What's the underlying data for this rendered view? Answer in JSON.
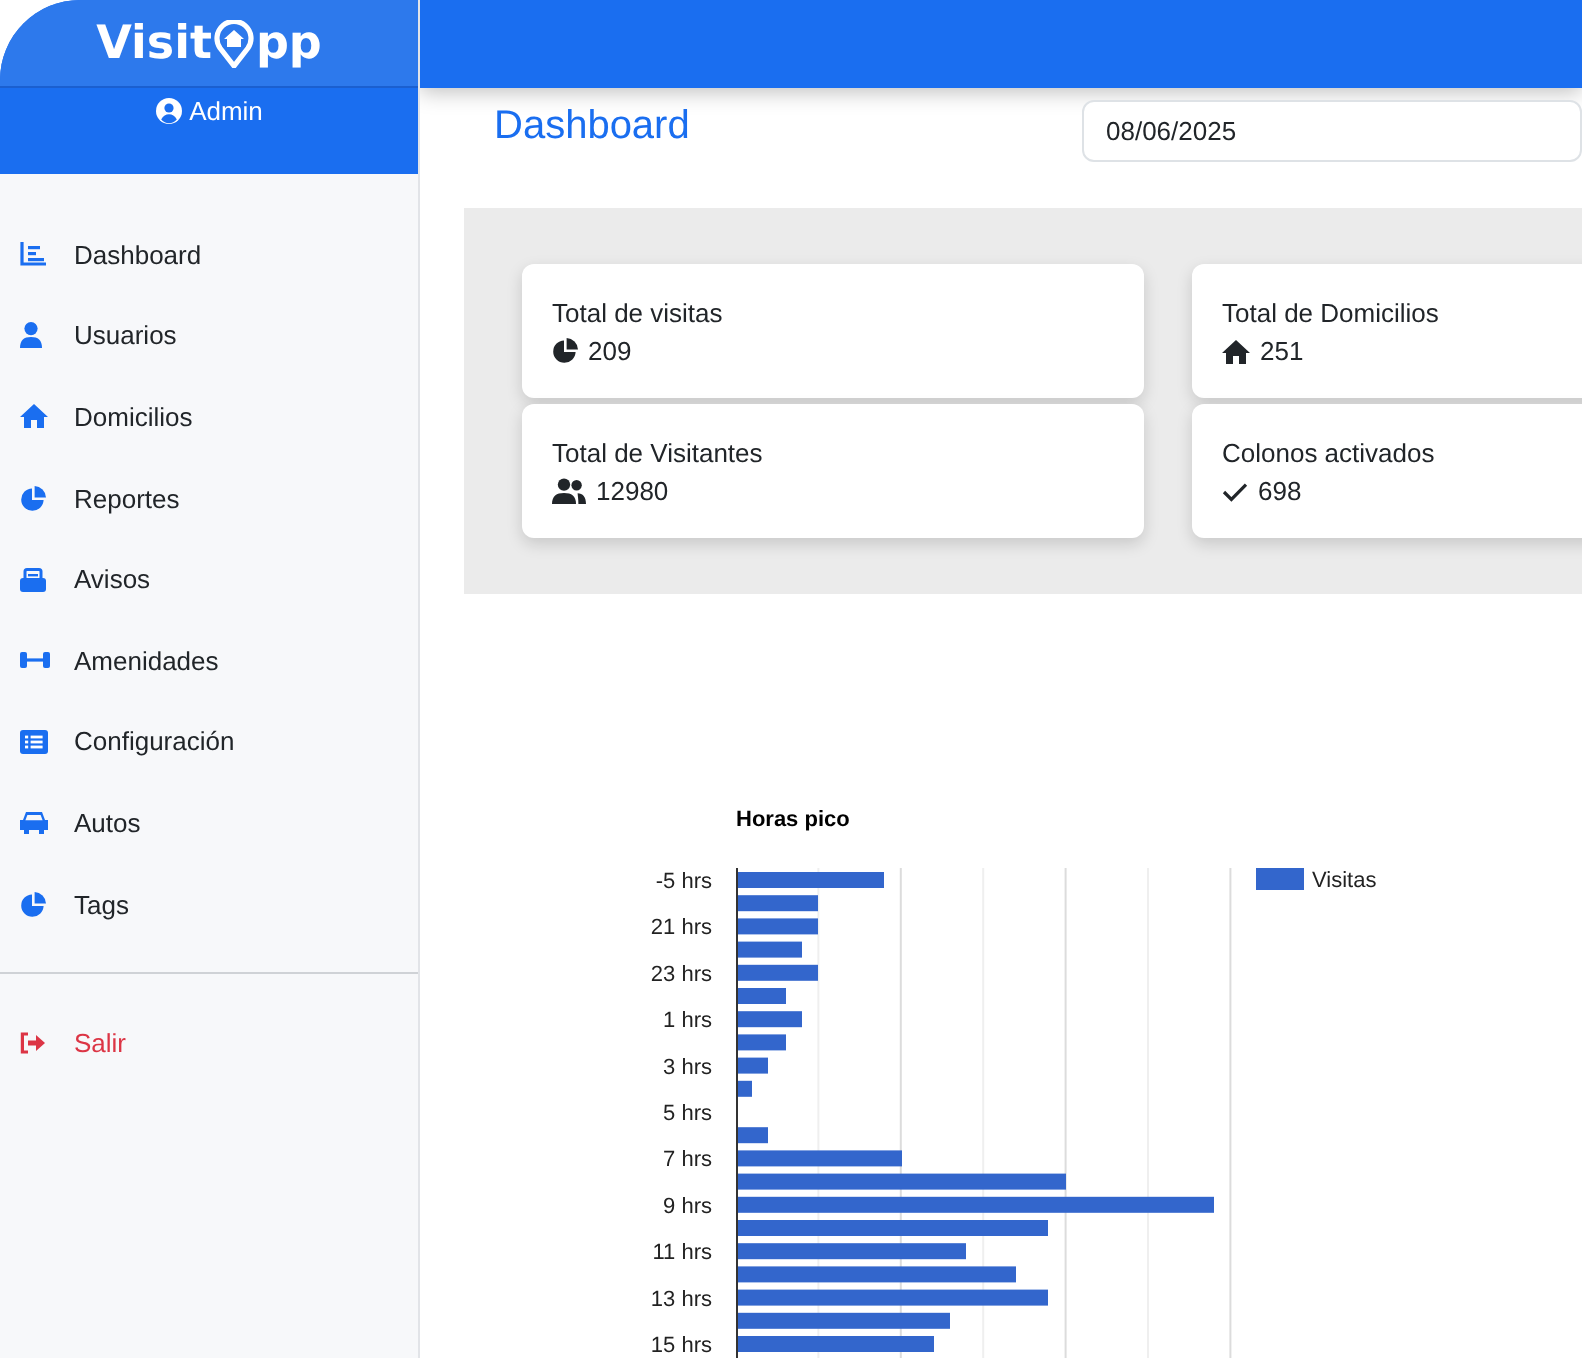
{
  "brand": {
    "text_before": "Visit",
    "text_after": "pp"
  },
  "user": {
    "name": "Admin"
  },
  "sidebar": {
    "items": [
      {
        "label": "Dashboard",
        "kind": "nav"
      },
      {
        "label": "Usuarios",
        "kind": "nav"
      },
      {
        "label": "Domicilios",
        "kind": "nav"
      },
      {
        "label": "Reportes",
        "kind": "nav"
      },
      {
        "label": "Avisos",
        "kind": "nav"
      },
      {
        "label": "Amenidades",
        "kind": "nav"
      },
      {
        "label": "Configuración",
        "kind": "nav"
      },
      {
        "label": "Autos",
        "kind": "nav"
      },
      {
        "label": "Tags",
        "kind": "nav"
      },
      {
        "label": "Salir",
        "kind": "logout"
      }
    ]
  },
  "page": {
    "title": "Dashboard",
    "date_field": {
      "value": "08/06/2025"
    }
  },
  "stats": [
    {
      "label": "Total de visitas",
      "value": "209"
    },
    {
      "label": "Total de Domicilios",
      "value": "251"
    },
    {
      "label": "Total de Visitantes",
      "value": "12980"
    },
    {
      "label": "Colonos activados",
      "value": "698"
    }
  ],
  "chart": {
    "title": "Horas pico",
    "legend": "Visitas",
    "category_labels": [
      "-5 hrs",
      "21 hrs",
      "23 hrs",
      "1 hrs",
      "3 hrs",
      "5 hrs",
      "7 hrs",
      "9 hrs",
      "11 hrs",
      "13 hrs",
      "15 hrs"
    ]
  }
}
